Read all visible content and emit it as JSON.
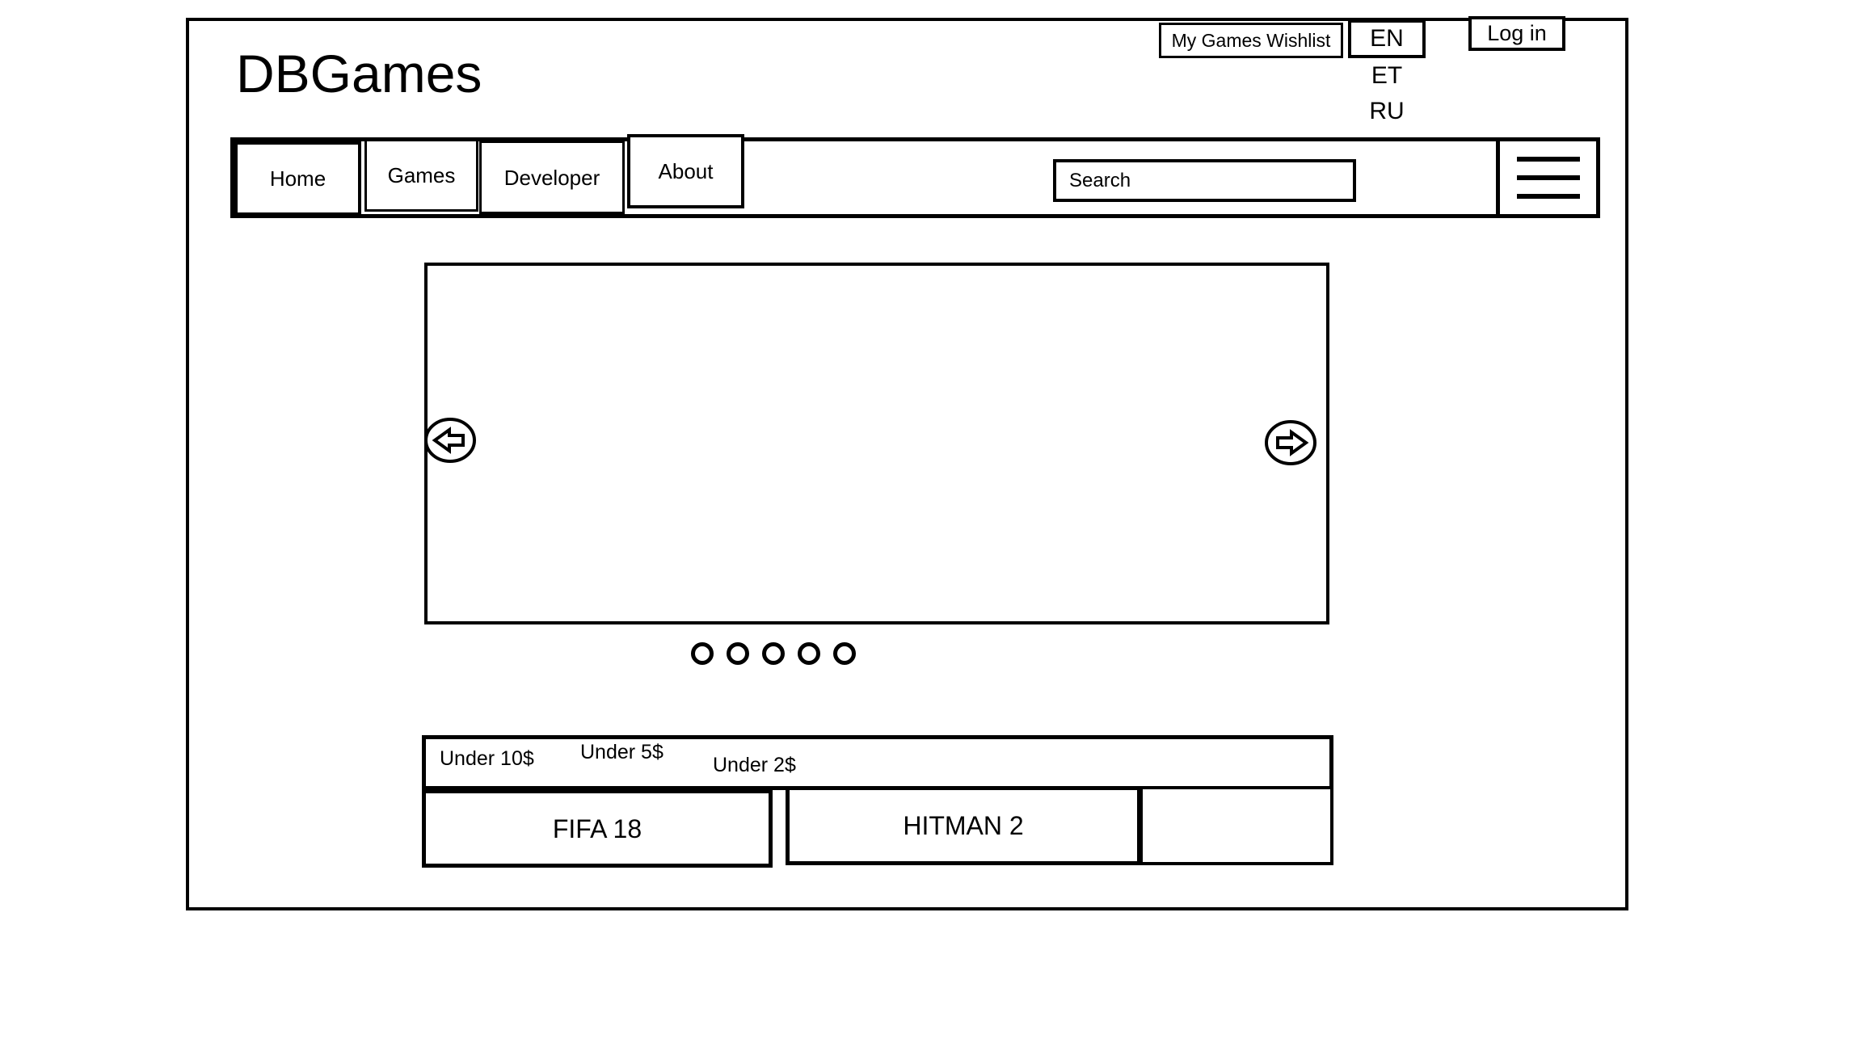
{
  "site": {
    "logo": "DBGames"
  },
  "topbar": {
    "wishlist_label": "My Games Wishlist",
    "login_label": "Log in",
    "language": {
      "selected": "EN",
      "options": [
        "ET",
        "RU"
      ]
    }
  },
  "nav": {
    "items": [
      {
        "label": "Home"
      },
      {
        "label": "Games"
      },
      {
        "label": "Developer"
      },
      {
        "label": "About"
      }
    ],
    "search": {
      "placeholder": "Search",
      "value": ""
    },
    "menu_icon": "hamburger-menu-icon"
  },
  "carousel": {
    "prev_icon": "arrow-left-circle-icon",
    "next_icon": "arrow-right-circle-icon",
    "slide_count": 5,
    "active_slide": 0
  },
  "deals": {
    "filters": [
      {
        "label": "Under 10$"
      },
      {
        "label": "Under 5$"
      },
      {
        "label": "Under 2$"
      }
    ],
    "cards": [
      {
        "title": "FIFA 18"
      },
      {
        "title": "HITMAN 2"
      },
      {
        "title": ""
      }
    ]
  },
  "colors": {
    "ink": "#000000",
    "paper": "#ffffff"
  }
}
